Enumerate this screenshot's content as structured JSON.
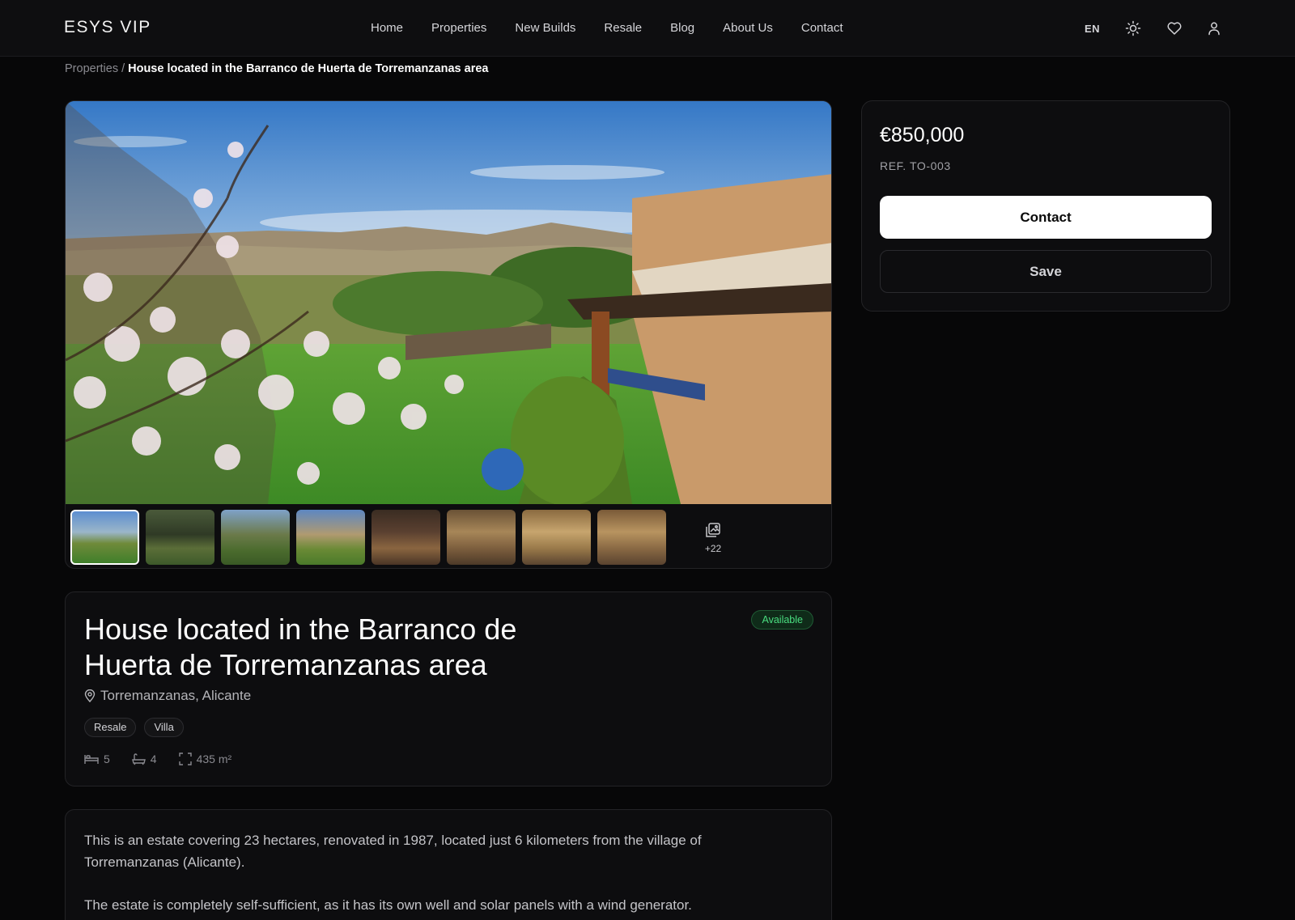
{
  "header": {
    "logo": "ESYS VIP",
    "nav": [
      "Home",
      "Properties",
      "New Builds",
      "Resale",
      "Blog",
      "About Us",
      "Contact"
    ],
    "lang": "EN",
    "icons": [
      "sun-icon",
      "heart-icon",
      "user-icon"
    ]
  },
  "breadcrumb": {
    "parent": "Properties",
    "separator": "/",
    "current": "House located in the Barranco de Huerta de Torremanzanas area"
  },
  "gallery": {
    "more_count": "+22",
    "thumbnail_count": 8
  },
  "listing": {
    "title": "House located in the Barranco de Huerta de Torremanzanas area",
    "status": "Available",
    "location": "Torremanzanas, Alicante",
    "tags": [
      "Resale",
      "Villa"
    ],
    "bedrooms": "5",
    "bathrooms": "4",
    "area": "435 m²",
    "description": [
      "This is an estate covering 23 hectares, renovated in 1987, located just 6 kilometers from the village of Torremanzanas (Alicante).",
      "The estate is completely self-sufficient, as it has its own well and solar panels with a wind generator."
    ]
  },
  "pricing": {
    "price": "€850,000",
    "ref": "REF. TO-003",
    "contact_label": "Contact",
    "save_label": "Save"
  },
  "colors": {
    "background": "#070708",
    "card": "#0d0d0f",
    "status_green": "#4ade80"
  }
}
